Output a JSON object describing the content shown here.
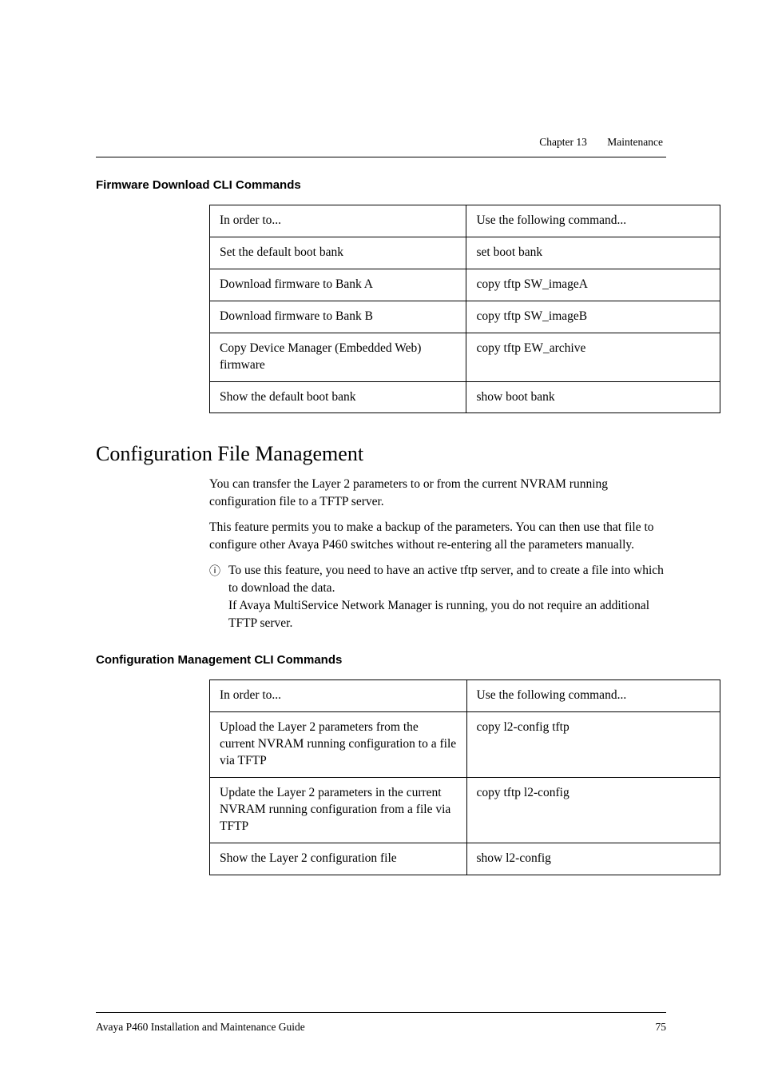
{
  "header": {
    "chapter_label": "Chapter 13",
    "chapter_title": "Maintenance"
  },
  "firmware": {
    "heading": "Firmware Download CLI Commands",
    "col_in_order_to": "In order to...",
    "col_command": "Use the following command...",
    "rows": [
      {
        "left": "Set the default boot bank",
        "right": "set boot bank"
      },
      {
        "left": "Download firmware to Bank A",
        "right": "copy tftp SW_imageA"
      },
      {
        "left": "Download firmware to Bank B",
        "right": "copy tftp SW_imageB"
      },
      {
        "left": "Copy Device Manager (Embedded Web) firmware",
        "right": "copy tftp EW_archive"
      },
      {
        "left": "Show the default boot bank",
        "right": "show boot bank"
      }
    ]
  },
  "config": {
    "title": "Configuration File Management",
    "para1": "You can transfer the Layer 2 parameters to or from the current NVRAM running configuration file to a TFTP server.",
    "para2": "This feature permits you to make a backup of the parameters. You can then use that file to configure other Avaya P460 switches without re-entering all the parameters manually.",
    "note_line1": "To use this feature, you need to have an active tftp server, and to create a file into which to download the data.",
    "note_line2": "If Avaya MultiService Network Manager is running, you do not require an additional TFTP server.",
    "note_marker": "ⓘ"
  },
  "config_cli": {
    "heading": "Configuration Management CLI Commands",
    "col_in_order_to": "In order to...",
    "col_command": "Use the following command...",
    "rows": [
      {
        "left": "Upload the Layer 2 parameters from the current NVRAM running configuration to a file via TFTP",
        "right": "copy l2-config tftp"
      },
      {
        "left": "Update the Layer 2 parameters in the current NVRAM running configuration from a file via TFTP",
        "right": "copy tftp l2-config"
      },
      {
        "left": "Show the Layer 2 configuration file",
        "right": "show l2-config"
      }
    ]
  },
  "footer": {
    "doc_title": "Avaya P460 Installation and Maintenance Guide",
    "page_number": "75"
  }
}
